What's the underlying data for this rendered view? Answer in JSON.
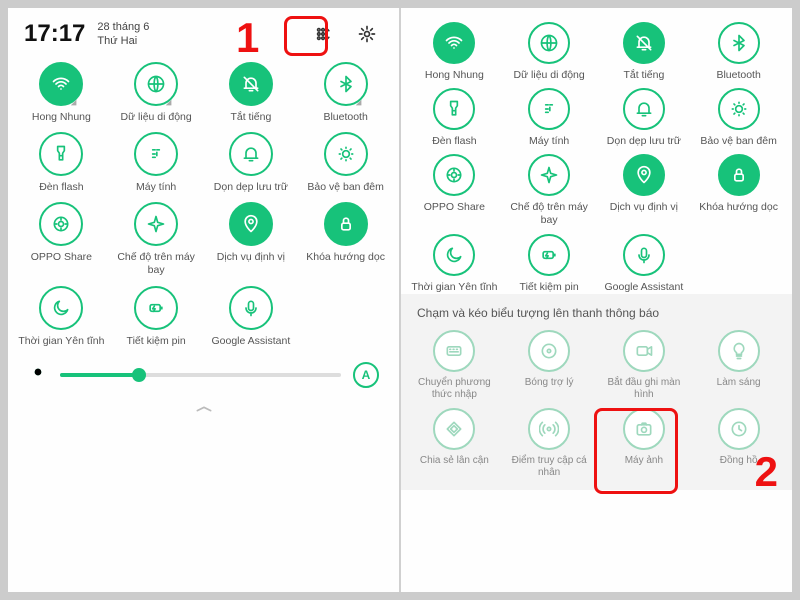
{
  "left": {
    "clock": "17:17",
    "date_line1": "28 tháng 6",
    "date_line2": "Thứ Hai",
    "step_num": "1",
    "tiles": [
      {
        "label": "Hong Nhung",
        "icon": "wifi",
        "filled": true,
        "caret": true
      },
      {
        "label": "Dữ liệu di động",
        "icon": "globe",
        "filled": false,
        "caret": true
      },
      {
        "label": "Tắt tiếng",
        "icon": "bell-off",
        "filled": true,
        "caret": false
      },
      {
        "label": "Bluetooth",
        "icon": "bluetooth",
        "filled": false,
        "caret": true
      },
      {
        "label": "Đèn flash",
        "icon": "flashlight",
        "filled": false,
        "caret": false
      },
      {
        "label": "Máy tính",
        "icon": "calculator",
        "filled": false,
        "caret": false
      },
      {
        "label": "Dọn dẹp lưu trữ",
        "icon": "bell",
        "filled": false,
        "caret": false
      },
      {
        "label": "Bảo vệ ban đêm",
        "icon": "sun-dim",
        "filled": false,
        "caret": false
      },
      {
        "label": "OPPO Share",
        "icon": "share",
        "filled": false,
        "caret": false
      },
      {
        "label": "Chế độ trên máy bay",
        "icon": "airplane",
        "filled": false,
        "caret": false
      },
      {
        "label": "Dịch vụ định vị",
        "icon": "location",
        "filled": true,
        "caret": false
      },
      {
        "label": "Khóa hướng dọc",
        "icon": "lock",
        "filled": true,
        "caret": false
      },
      {
        "label": "Thời gian Yên tĩnh",
        "icon": "moon",
        "filled": false,
        "caret": false
      },
      {
        "label": "Tiết kiệm pin",
        "icon": "battery",
        "filled": false,
        "caret": false
      },
      {
        "label": "Google Assistant",
        "icon": "mic",
        "filled": false,
        "caret": false
      }
    ],
    "auto_label": "A"
  },
  "right": {
    "step_num": "2",
    "tiles": [
      {
        "label": "Hong Nhung",
        "icon": "wifi",
        "filled": true
      },
      {
        "label": "Dữ liệu di động",
        "icon": "globe",
        "filled": false
      },
      {
        "label": "Tắt tiếng",
        "icon": "bell-off",
        "filled": true
      },
      {
        "label": "Bluetooth",
        "icon": "bluetooth",
        "filled": false
      },
      {
        "label": "Đèn flash",
        "icon": "flashlight",
        "filled": false
      },
      {
        "label": "Máy tính",
        "icon": "calculator",
        "filled": false
      },
      {
        "label": "Dọn dẹp lưu trữ",
        "icon": "bell",
        "filled": false
      },
      {
        "label": "Bảo vệ ban đêm",
        "icon": "sun-dim",
        "filled": false
      },
      {
        "label": "OPPO Share",
        "icon": "share",
        "filled": false
      },
      {
        "label": "Chế độ trên máy bay",
        "icon": "airplane",
        "filled": false
      },
      {
        "label": "Dịch vụ định vị",
        "icon": "location",
        "filled": true
      },
      {
        "label": "Khóa hướng dọc",
        "icon": "lock",
        "filled": true
      },
      {
        "label": "Thời gian Yên tĩnh",
        "icon": "moon",
        "filled": false
      },
      {
        "label": "Tiết kiệm pin",
        "icon": "battery",
        "filled": false
      },
      {
        "label": "Google Assistant",
        "icon": "mic",
        "filled": false
      }
    ],
    "tray_label": "Chạm và kéo biểu tượng lên thanh thông báo",
    "tray_tiles": [
      {
        "label": "Chuyển phương thức nhập",
        "icon": "keyboard"
      },
      {
        "label": "Bóng trợ lý",
        "icon": "circle-dot"
      },
      {
        "label": "Bắt đầu ghi màn hình",
        "icon": "record"
      },
      {
        "label": "Làm sáng",
        "icon": "bulb"
      },
      {
        "label": "Chia sẻ lân cận",
        "icon": "nearby"
      },
      {
        "label": "Điểm truy cập cá nhân",
        "icon": "hotspot"
      },
      {
        "label": "Máy ảnh",
        "icon": "camera"
      },
      {
        "label": "Đồng hồ",
        "icon": "clock"
      }
    ]
  }
}
